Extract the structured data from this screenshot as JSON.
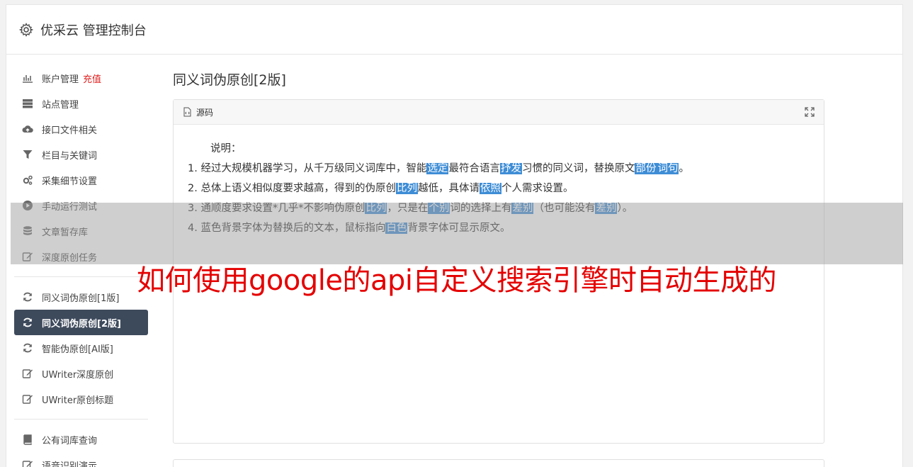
{
  "header": {
    "title": "优采云 管理控制台",
    "icon": "gear-icon"
  },
  "sidebar": {
    "group1": [
      {
        "label": "账户管理",
        "badge": "充值",
        "icon": "bar-chart-icon"
      },
      {
        "label": "站点管理",
        "icon": "server-icon"
      },
      {
        "label": "接口文件相关",
        "icon": "cloud-upload-icon"
      },
      {
        "label": "栏目与关键词",
        "icon": "filter-icon"
      },
      {
        "label": "采集细节设置",
        "icon": "cogs-icon"
      },
      {
        "label": "手动运行测试",
        "icon": "play-circle-icon"
      },
      {
        "label": "文章暂存库",
        "icon": "database-icon"
      },
      {
        "label": "深度原创任务",
        "icon": "edit-icon"
      }
    ],
    "group2": [
      {
        "label": "同义词伪原创[1版]",
        "icon": "refresh-icon"
      },
      {
        "label": "同义词伪原创[2版]",
        "icon": "refresh-icon",
        "active": true
      },
      {
        "label": "智能伪原创[AI版]",
        "icon": "refresh-icon"
      },
      {
        "label": "UWriter深度原创",
        "icon": "edit-icon"
      },
      {
        "label": "UWriter原创标题",
        "icon": "edit-icon"
      }
    ],
    "group3": [
      {
        "label": "公有词库查询",
        "icon": "book-icon"
      },
      {
        "label": "语音识别演示",
        "icon": "edit-icon"
      }
    ]
  },
  "main": {
    "title": "同义词伪原创[2版]",
    "editor": {
      "toolbar_label": "源码",
      "intro": "说明：",
      "lines": [
        [
          {
            "t": "1. 经过大规模机器学习，从千万级同义词库中，智能"
          },
          {
            "t": "选定",
            "hl": true
          },
          {
            "t": "最符合语言"
          },
          {
            "t": "抒发",
            "hl": true
          },
          {
            "t": "习惯的同义词，替换原文"
          },
          {
            "t": "部份",
            "hl": true
          },
          {
            "t": "词句",
            "hl": true
          },
          {
            "t": "。"
          }
        ],
        [
          {
            "t": "2. 总体上语义相似度要求越高，得到的伪原创"
          },
          {
            "t": "比列",
            "hl": true
          },
          {
            "t": "越低，具体请"
          },
          {
            "t": "依照",
            "hl": true
          },
          {
            "t": "个人需求设置。"
          }
        ],
        [
          {
            "t": "3. 通顺度要求设置*几乎*不影响伪原创"
          },
          {
            "t": "比列",
            "hl": true
          },
          {
            "t": "，只是在"
          },
          {
            "t": "个别",
            "hl": true
          },
          {
            "t": "词的选择上有"
          },
          {
            "t": "差别",
            "hl": true
          },
          {
            "t": "（也可能没有"
          },
          {
            "t": "差别",
            "hl": true
          },
          {
            "t": "）。"
          }
        ],
        [
          {
            "t": "4. 蓝色背景字体为替换后的文本，鼠标指向"
          },
          {
            "t": "白色",
            "hl": true
          },
          {
            "t": "背景字体可显示原文。"
          }
        ]
      ]
    }
  },
  "caption": "如何使用google的api自定义搜索引擎时自动生成的",
  "colors": {
    "highlight": "#3e8dd6",
    "active_nav": "#3d4a5c",
    "caption": "#e50000",
    "badge": "#e02020"
  }
}
